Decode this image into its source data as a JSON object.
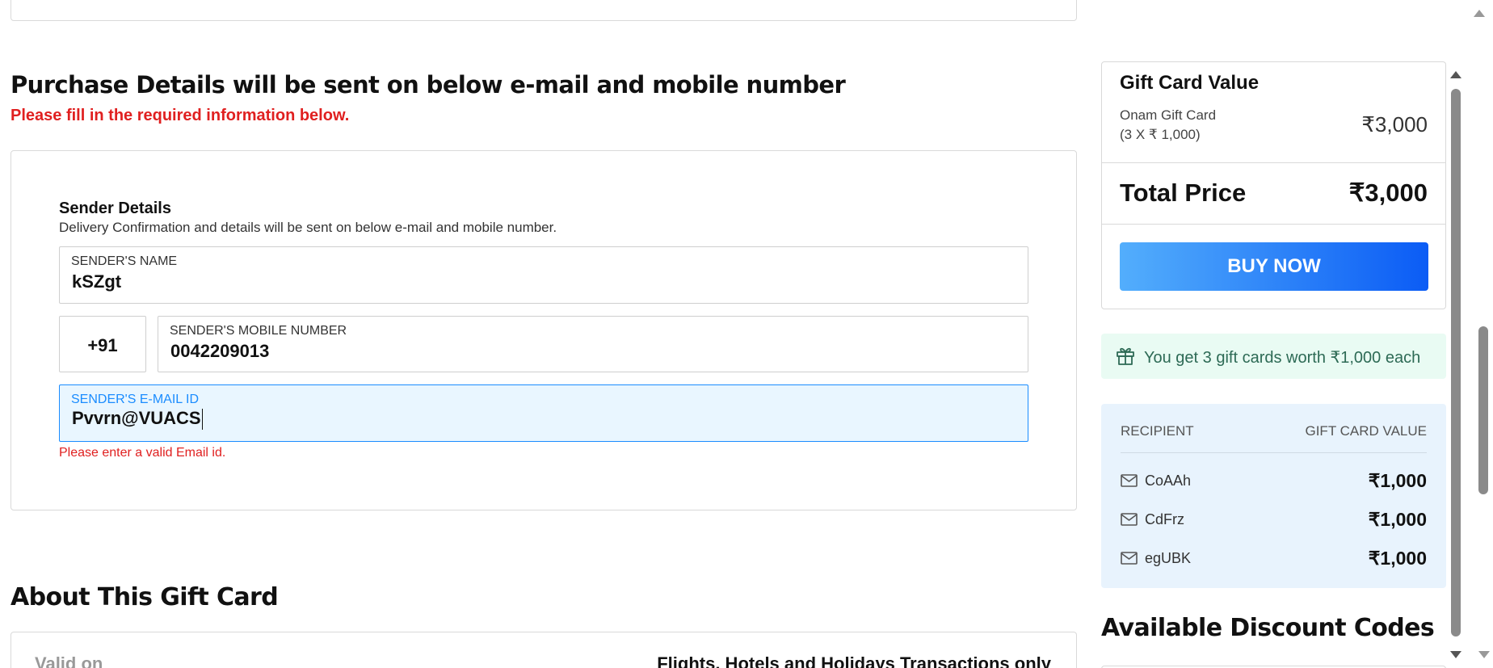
{
  "purchase": {
    "title": "Purchase Details will be sent on below e-mail and mobile number",
    "subtitle": "Please fill in the required information below."
  },
  "sender": {
    "title": "Sender Details",
    "description": "Delivery Confirmation and details will be sent on below e-mail and mobile number.",
    "name_label": "SENDER'S NAME",
    "name_value": "kSZgt",
    "country_code": "+91",
    "mobile_label": "SENDER'S MOBILE NUMBER",
    "mobile_value": "0042209013",
    "email_label": "SENDER'S E-MAIL ID",
    "email_value": "Pvvrn@VUACS",
    "email_error": "Please enter a valid Email id."
  },
  "about": {
    "title": "About This Gift Card",
    "valid_on_label": "Valid on",
    "valid_on_value": "Flights, Hotels and Holidays Transactions only"
  },
  "summary": {
    "title": "Gift Card Value",
    "card_name": "Onam Gift Card",
    "card_qty": "(3 X ₹ 1,000)",
    "card_price": "₹3,000",
    "total_label": "Total Price",
    "total_price": "₹3,000",
    "buy_label": "BUY NOW"
  },
  "gift_note": {
    "icon": "gift-icon",
    "text": "You get 3 gift cards worth ₹1,000 each"
  },
  "recipients": {
    "header_recipient": "RECIPIENT",
    "header_value": "GIFT CARD VALUE",
    "rows": [
      {
        "name": "CoAAh",
        "value": "₹1,000"
      },
      {
        "name": "CdFrz",
        "value": "₹1,000"
      },
      {
        "name": "egUBK",
        "value": "₹1,000"
      }
    ]
  },
  "discount": {
    "title": "Available Discount Codes"
  },
  "colors": {
    "error_red": "#e02020",
    "accent_blue": "#1a8cff",
    "buy_gradient_start": "#53aefc",
    "buy_gradient_end": "#0b5cf5",
    "gift_note_bg": "#e9fbf3",
    "recipient_bg": "#e8f3fd"
  }
}
